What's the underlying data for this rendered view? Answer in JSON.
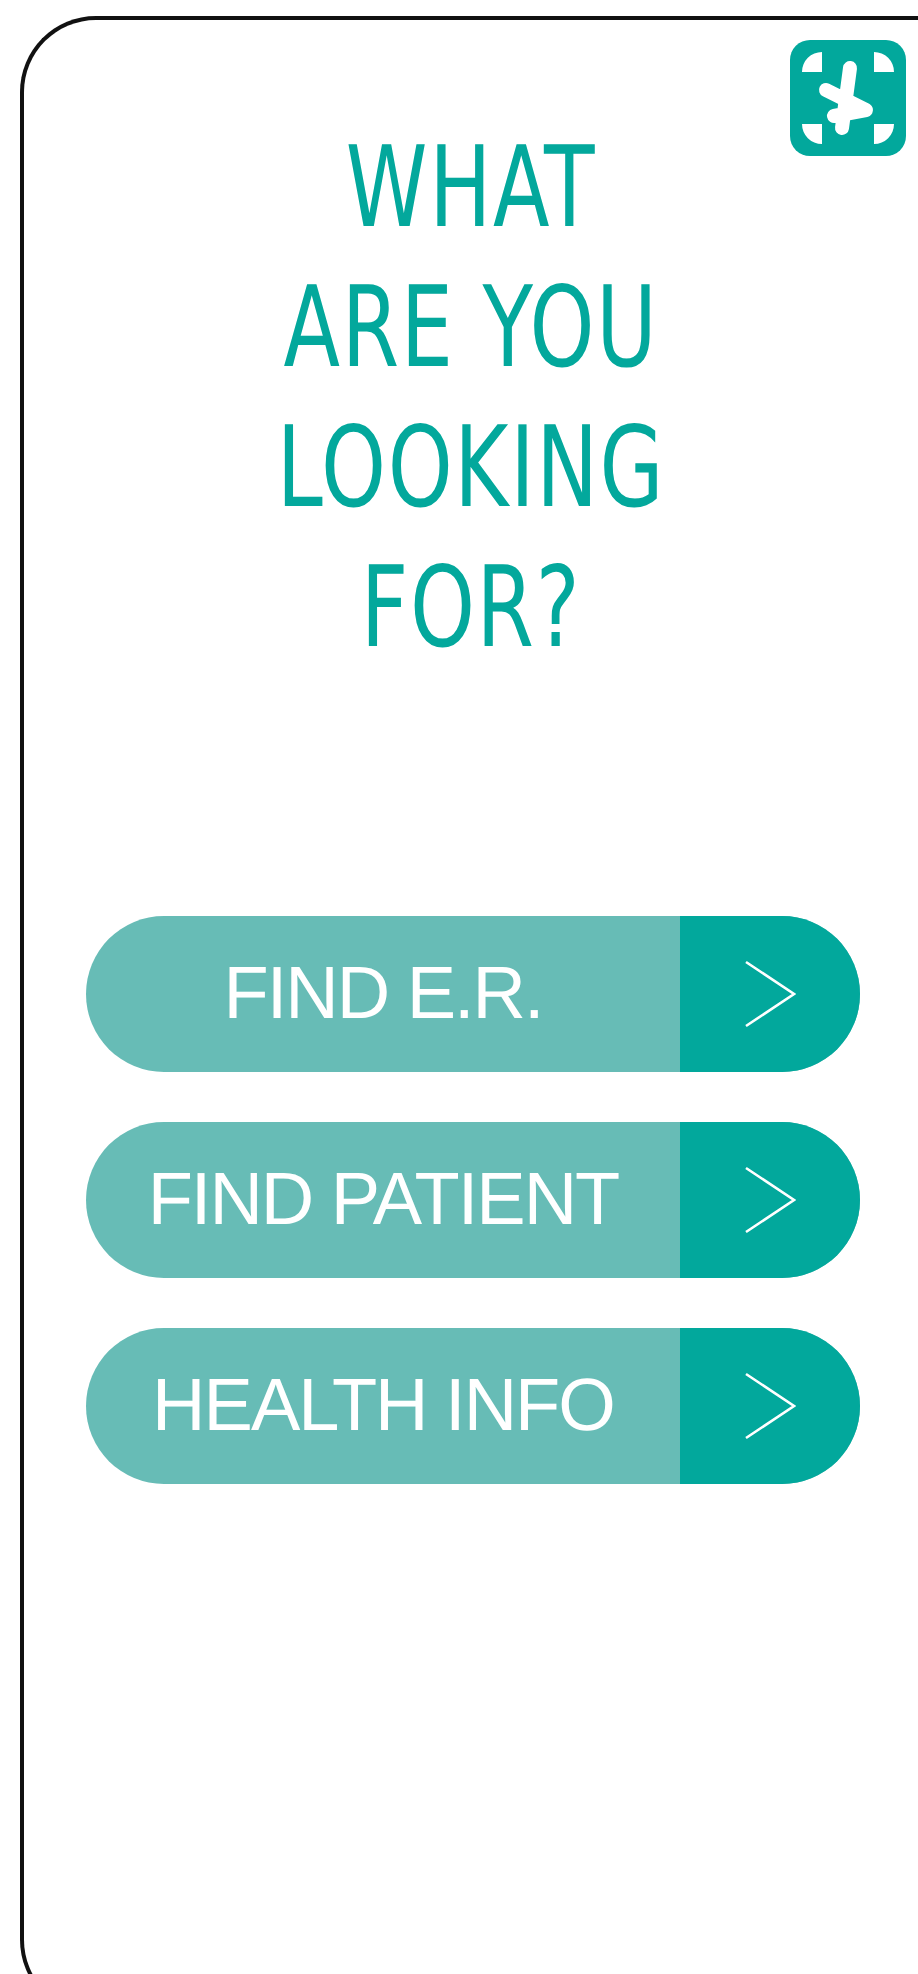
{
  "title": "WHAT\nARE YOU\nLOOKING\nFOR?",
  "buttons": [
    {
      "label": "FIND E.R."
    },
    {
      "label": "FIND PATIENT"
    },
    {
      "label": "HEALTH INFO"
    }
  ]
}
